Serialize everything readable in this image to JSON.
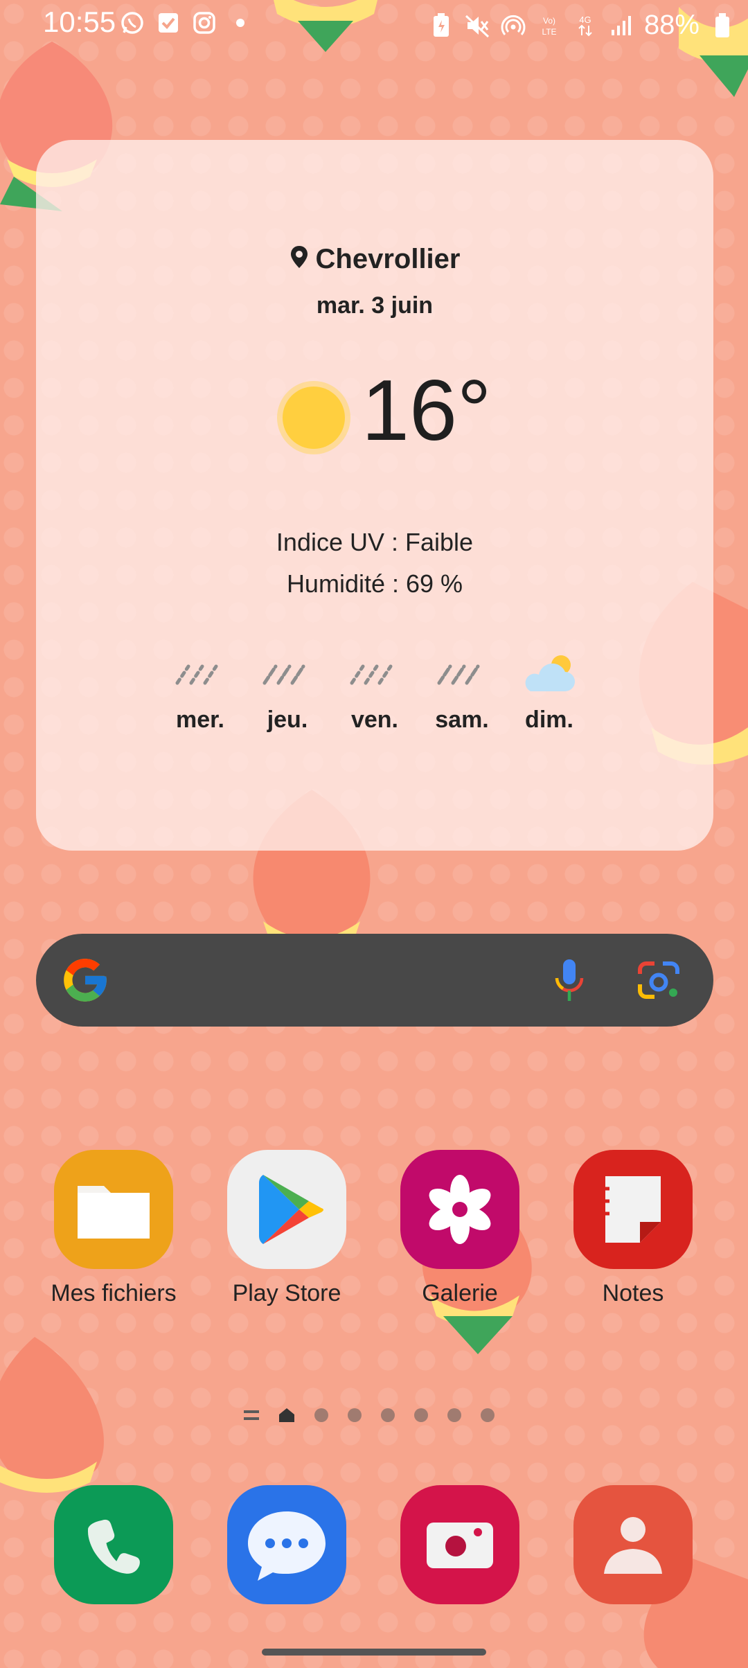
{
  "status_bar": {
    "time": "10:55",
    "battery": "88%",
    "left_icons": [
      "whatsapp-icon",
      "tasks-icon",
      "instagram-icon",
      "dot-icon"
    ],
    "right_icons": [
      "battery-saver-icon",
      "mute-icon",
      "hotspot-icon",
      "volte-icon",
      "4g-icon",
      "signal-icon",
      "battery-icon"
    ]
  },
  "weather": {
    "location": "Chevrollier",
    "date": "mar. 3 juin",
    "temperature": "16°",
    "uv": "Indice UV : Faible",
    "humidity": "Humidité : 69 %",
    "forecast": [
      {
        "day": "mer.",
        "icon": "rain-icon"
      },
      {
        "day": "jeu.",
        "icon": "rain-icon"
      },
      {
        "day": "ven.",
        "icon": "rain-icon"
      },
      {
        "day": "sam.",
        "icon": "rain-icon"
      },
      {
        "day": "dim.",
        "icon": "partly-cloudy-icon"
      }
    ]
  },
  "search": {
    "icons": [
      "google-logo",
      "mic-icon",
      "google-lens-icon"
    ]
  },
  "apps": [
    {
      "label": "Mes fichiers",
      "icon": "folder-icon",
      "color": "#eea21a"
    },
    {
      "label": "Play Store",
      "icon": "play-store-icon",
      "color": "#efefef"
    },
    {
      "label": "Galerie",
      "icon": "flower-icon",
      "color": "#c10a6a"
    },
    {
      "label": "Notes",
      "icon": "notes-icon",
      "color": "#d8231e"
    }
  ],
  "dock": [
    {
      "name": "phone",
      "icon": "phone-icon",
      "color": "#0c9a56"
    },
    {
      "name": "messages",
      "icon": "chat-icon",
      "color": "#2a73e8"
    },
    {
      "name": "camera",
      "icon": "camera-icon",
      "color": "#d4144a"
    },
    {
      "name": "contacts",
      "icon": "contact-icon",
      "color": "#e5543f"
    }
  ],
  "pager": {
    "pages": 8,
    "current": 1
  }
}
